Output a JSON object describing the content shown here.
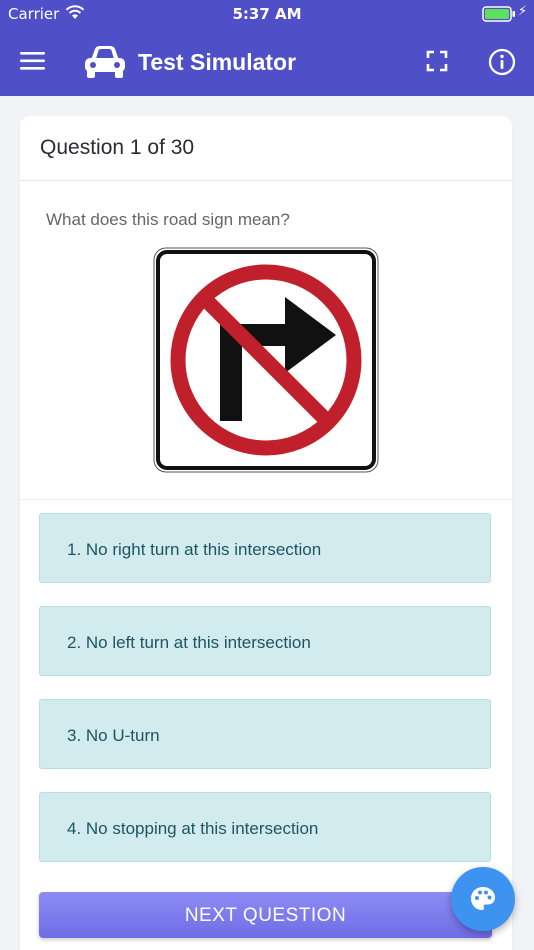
{
  "status": {
    "carrier": "Carrier",
    "time": "5:37 AM"
  },
  "nav": {
    "title": "Test Simulator",
    "icons": [
      "menu-icon",
      "car-icon",
      "fullscreen-icon",
      "info-icon"
    ]
  },
  "question": {
    "header": "Question 1 of 30",
    "prompt": "What does this road sign mean?",
    "image": "no-right-turn-sign"
  },
  "answers": [
    "1. No right turn at this intersection",
    "2. No left turn at this intersection",
    "3. No U-turn",
    "4. No stopping at this intersection"
  ],
  "next_button": "NEXT QUESTION",
  "fab": {
    "icon": "palette-icon"
  },
  "colors": {
    "brand": "#4f4fc8",
    "answer_bg": "#d2ebef",
    "answer_text": "#1e5561",
    "button": "#7b7aed",
    "fab": "#3e92f0",
    "sign_red": "#c0202b"
  }
}
